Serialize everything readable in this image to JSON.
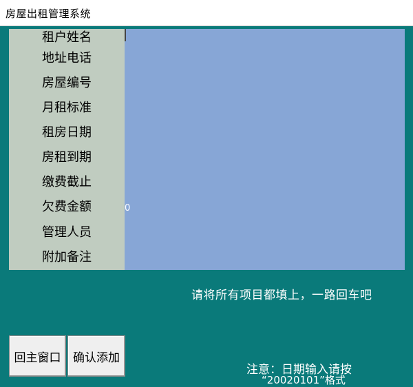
{
  "window": {
    "title": "房屋出租管理系统"
  },
  "form": {
    "fields": [
      {
        "label": "租户姓名",
        "value": ""
      },
      {
        "label": "地址电话",
        "value": ""
      },
      {
        "label": "房屋编号",
        "value": ""
      },
      {
        "label": "月租标准",
        "value": ""
      },
      {
        "label": "租房日期",
        "value": ""
      },
      {
        "label": "房租到期",
        "value": ""
      },
      {
        "label": "缴费截止",
        "value": ""
      },
      {
        "label": "欠费金额",
        "value": "0"
      },
      {
        "label": "管理人员",
        "value": ""
      },
      {
        "label": "附加备注",
        "value": ""
      }
    ]
  },
  "hint": "请将所有项目都填上，一路回车吧",
  "buttons": {
    "back": "回主窗口",
    "add": "确认添加"
  },
  "note": {
    "line1": "注意：日期输入请按",
    "line2": "“20020101”格式"
  },
  "colors": {
    "background": "#0a7a7a",
    "form_bg": "#87a6d6",
    "label_bg": "#c0ccc0"
  }
}
